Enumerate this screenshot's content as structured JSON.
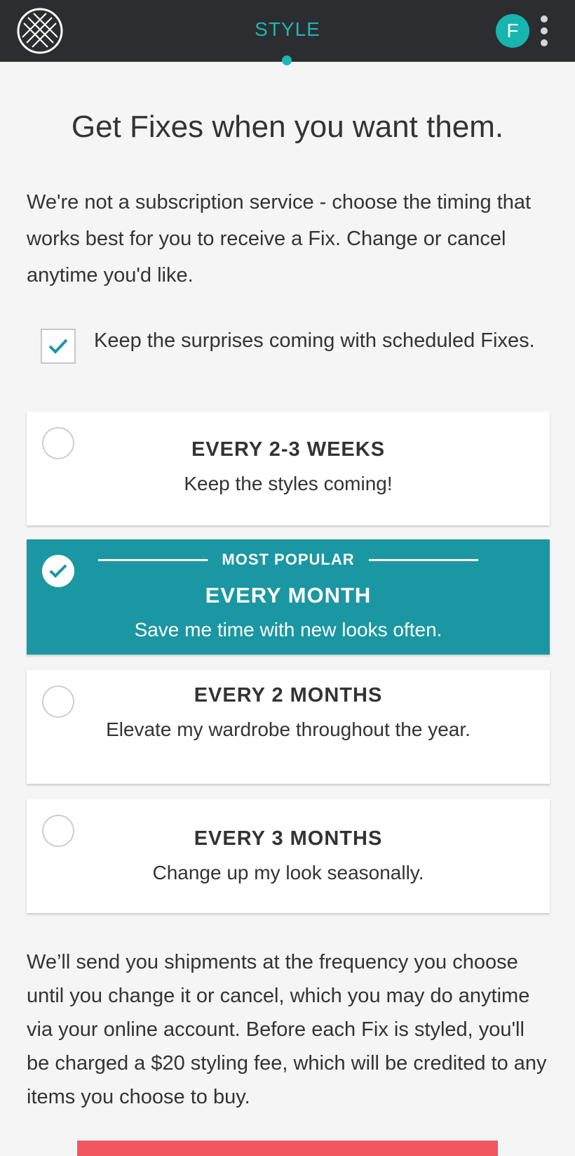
{
  "header": {
    "tab_label": "STYLE",
    "avatar_initial": "F"
  },
  "main": {
    "headline": "Get Fixes when you want them.",
    "intro": "We're not a subscription service - choose the timing that works best for you to receive a Fix. Change or cancel anytime you'd like.",
    "scheduled_checkbox": {
      "label": "Keep the surprises coming with scheduled Fixes.",
      "checked": true
    },
    "options": [
      {
        "title": "EVERY 2-3 WEEKS",
        "subtitle": "Keep the styles coming!",
        "selected": false
      },
      {
        "badge": "MOST POPULAR",
        "title": "EVERY MONTH",
        "subtitle": "Save me time with new looks often.",
        "selected": true
      },
      {
        "title": "EVERY 2 MONTHS",
        "subtitle": "Elevate my wardrobe throughout the year.",
        "selected": false
      },
      {
        "title": "EVERY 3 MONTHS",
        "subtitle": "Change up my look seasonally.",
        "selected": false
      }
    ],
    "disclaimer": "We’ll send you shipments at the frequency you choose until you change it or cancel, which you may do anytime via your online account. Before each Fix is styled, you'll be charged a $20 styling fee, which will be credited to any items you choose to buy."
  },
  "colors": {
    "topbar": "#2b2d31",
    "accent": "#1fb5b5",
    "selected_option": "#1a97a3",
    "cta": "#f0585e"
  }
}
